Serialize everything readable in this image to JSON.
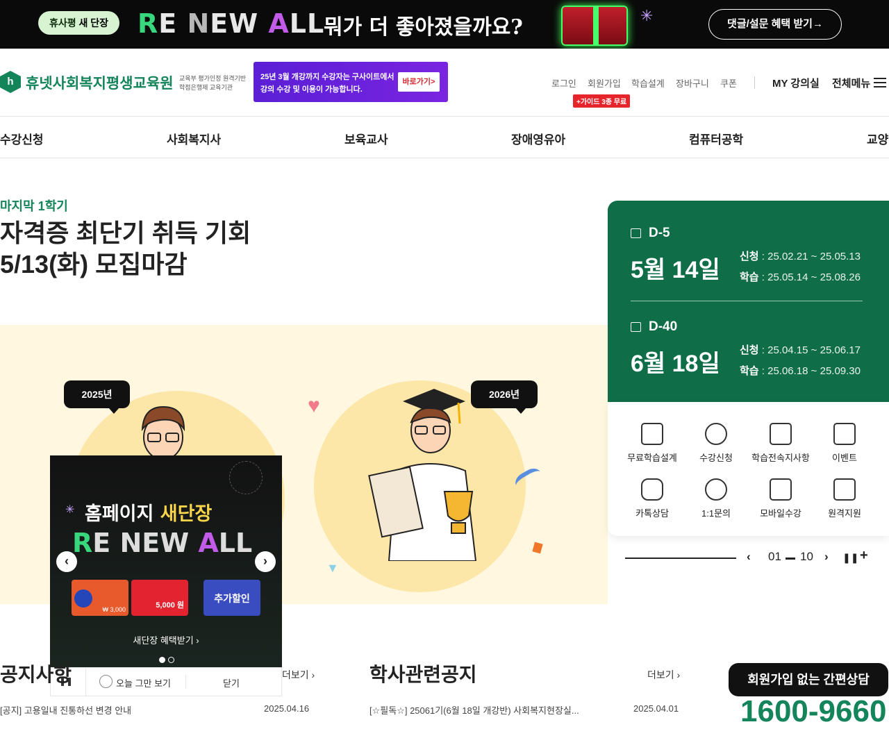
{
  "top_banner": {
    "pill_prefix": "휴사평 ",
    "pill_bold": "새 단장",
    "renew_parts": [
      "R",
      "E ",
      "N",
      "EW ",
      "A",
      "LL"
    ],
    "question": "뭐가 더 좋아졌을까요?",
    "cta": "댓글/설문 혜택 받기→"
  },
  "header": {
    "logo_mark": "h",
    "logo_name": "휴넷사회복지평생교육원",
    "logo_sub_1": "교육부 평가인정 원격기반",
    "logo_sub_2": "학점은행제 교육기관",
    "promo_line1_a": "25년 3월 개강까지 수강자는 ",
    "promo_line1_b": "구사이트에서",
    "promo_line2": "강의 수강 및 이용이 가능합니다.",
    "promo_button": "바로가기>",
    "util_links": [
      "로그인",
      "회원가입",
      "학습설계",
      "장바구니",
      "쿠폰"
    ],
    "guide_badge": "+가이드 3종 무료",
    "my_class": "MY 강의실",
    "all_menu": "전체메뉴"
  },
  "gnb": [
    "수강신청",
    "사회복지사",
    "보육교사",
    "장애영유아",
    "컴퓨터공학",
    "교양"
  ],
  "hero": {
    "kicker": "마지막 1학기",
    "title_line1": "자격증 최단기 취득 기회",
    "title_line2": "5/13(화) 모집마감",
    "bubble_left": "2025년",
    "bubble_right": "2026년"
  },
  "schedule": [
    {
      "dday": "D-5",
      "date": "5월 14일",
      "apply_label": "신청",
      "apply": " : 25.02.21 ~ 25.05.13",
      "study_label": "학습",
      "study": " : 25.05.14 ~ 25.08.26"
    },
    {
      "dday": "D-40",
      "date": "6월 18일",
      "apply_label": "신청",
      "apply": " : 25.04.15 ~ 25.06.17",
      "study_label": "학습",
      "study": " : 25.06.18 ~ 25.09.30"
    }
  ],
  "quick_menu": [
    {
      "label": "무료학습설계",
      "icon": "clipboard-icon"
    },
    {
      "label": "수강신청",
      "icon": "clock-icon"
    },
    {
      "label": "학습전속지사항",
      "icon": "document-search-icon"
    },
    {
      "label": "이벤트",
      "icon": "gift-icon"
    },
    {
      "label": "카톡상담",
      "icon": "talk-icon"
    },
    {
      "label": "1:1문의",
      "icon": "headset-icon"
    },
    {
      "label": "모바일수강",
      "icon": "mobile-icon"
    },
    {
      "label": "원격지원",
      "icon": "remote-icon"
    }
  ],
  "slider": {
    "current": "01",
    "total": "10",
    "progress": 0.1
  },
  "popup": {
    "headline_a": "홈페이지 ",
    "headline_b": "새단장",
    "renew_parts": [
      "R",
      "E ",
      "N",
      "EW ",
      "A",
      "LL"
    ],
    "card1_amount": "₩ 3,000",
    "card2_amount": "5,000 원",
    "card3_label": "추가할인",
    "benefit": "새단장 혜택받기  ›",
    "pause": "❚❚",
    "today_close": "오늘 그만 보기",
    "close": "닫기"
  },
  "notice": {
    "left_title": "공지사항",
    "left_more": "더보기 ›",
    "left_row": "[공지] 고용일내 진통하선 변경 안내",
    "left_date": "2025.04.16",
    "mid_title": "학사관련공지",
    "mid_more": "더보기 ›",
    "mid_row": "[☆필독☆] 25061기(6월 18일 개강반) 사회복지현장실...",
    "mid_date": "2025.04.01",
    "consult": "회원가입 없는 간편상담",
    "phone": "1600-9660"
  },
  "colors": {
    "brand_green": "#14845a",
    "schedule_bg": "#0f6e48",
    "promo_purple": "#6a22dc",
    "hero_bg": "#fff7e0"
  }
}
